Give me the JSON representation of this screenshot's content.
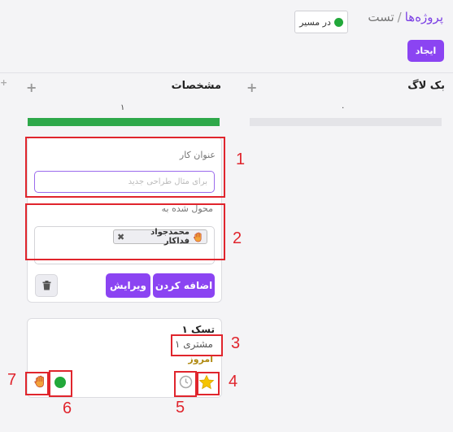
{
  "header": {
    "breadcrumb": {
      "root": "پروژه‌ها",
      "separator": "/",
      "current": "تست"
    },
    "status_label": "در مسیر",
    "status_color": "#22a83a",
    "create_label": "ایجاد"
  },
  "columns": [
    {
      "title": "بک لاگ",
      "count": "۰",
      "bar_color": "#e4e4e8"
    },
    {
      "title": "مشخصات",
      "count": "۱",
      "bar_color": "#2ea84a"
    }
  ],
  "new_task_form": {
    "title_label": "عنوان کار",
    "title_placeholder": "برای مثال طراحی جدید",
    "assigned_label": "محول شده به",
    "assignee": {
      "name": "محمدجواد فداکار",
      "icon": "hand-icon"
    },
    "add_label": "اضافه کردن",
    "edit_label": "ویرایش",
    "delete_icon": "trash-icon"
  },
  "task_card": {
    "title": "تسک ۱",
    "customer": "مشتری ۱",
    "date": "امروز",
    "icons": [
      "star-icon",
      "clock-icon",
      "status-dot-icon",
      "hand-icon"
    ],
    "status_color": "#22a83a",
    "star_color": "#f5c400"
  },
  "annotations": [
    "1",
    "2",
    "3",
    "4",
    "5",
    "6",
    "7"
  ],
  "accent_color": "#8b44f2",
  "annotation_color": "#e0252d"
}
